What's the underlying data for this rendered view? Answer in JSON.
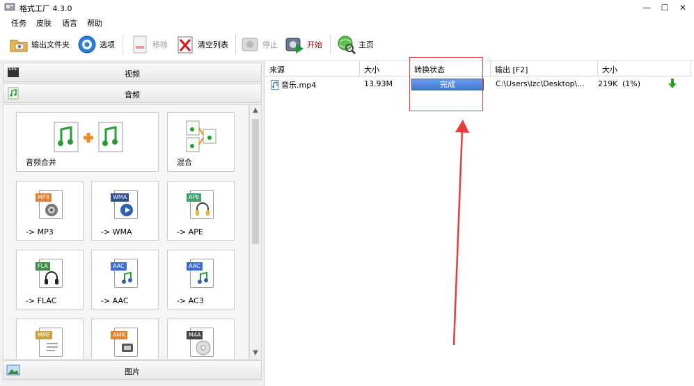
{
  "window": {
    "title": "格式工厂 4.3.0",
    "minimize": "—",
    "maximize": "☐",
    "close": "✕"
  },
  "menu": [
    "任务",
    "皮肤",
    "语言",
    "帮助"
  ],
  "toolbar": {
    "output_folder": "输出文件夹",
    "options": "选项",
    "remove": "移除",
    "clear_list": "清空列表",
    "stop": "停止",
    "start": "开始",
    "home": "主页"
  },
  "categories": {
    "video": "视频",
    "audio": "音频",
    "picture": "图片"
  },
  "tiles": [
    {
      "label": "音频合并",
      "icon": "audio-merge-icon"
    },
    {
      "label": "混合",
      "icon": "audio-mix-icon"
    },
    {
      "label": "-> MP3",
      "format": "MP3",
      "color": "#e6822c",
      "icon": "speaker-icon"
    },
    {
      "label": "-> WMA",
      "format": "WMA",
      "color": "#2d4f8f",
      "icon": "play-icon"
    },
    {
      "label": "-> APE",
      "format": "APE",
      "color": "#3fa36a",
      "icon": "headphones-icon"
    },
    {
      "label": "-> FLAC",
      "format": "FLA",
      "color": "#3f8f4a",
      "icon": "headset-icon"
    },
    {
      "label": "-> AAC",
      "format": "AAC",
      "color": "#3a6fd0",
      "icon": "music-note-icon"
    },
    {
      "label": "-> AC3",
      "format": "AAC",
      "color": "#3a6fd0",
      "icon": "music-note-icon"
    },
    {
      "label": "",
      "format": "MMF",
      "color": "#c8a23a",
      "icon": "document-icon"
    },
    {
      "label": "",
      "format": "AMR",
      "color": "#e6822c",
      "icon": "phone-icon"
    },
    {
      "label": "",
      "format": "M4A",
      "color": "#444444",
      "icon": "disc-icon"
    }
  ],
  "table": {
    "columns": [
      "来源",
      "大小",
      "转换状态",
      "输出 [F2]",
      "大小"
    ],
    "rows": [
      {
        "source": "音乐.mp4",
        "size": "13.93M",
        "status": "完成",
        "output": "C:\\Users\\lzc\\Desktop\\...",
        "out_size": "219K",
        "ratio": "(1%)"
      }
    ]
  }
}
